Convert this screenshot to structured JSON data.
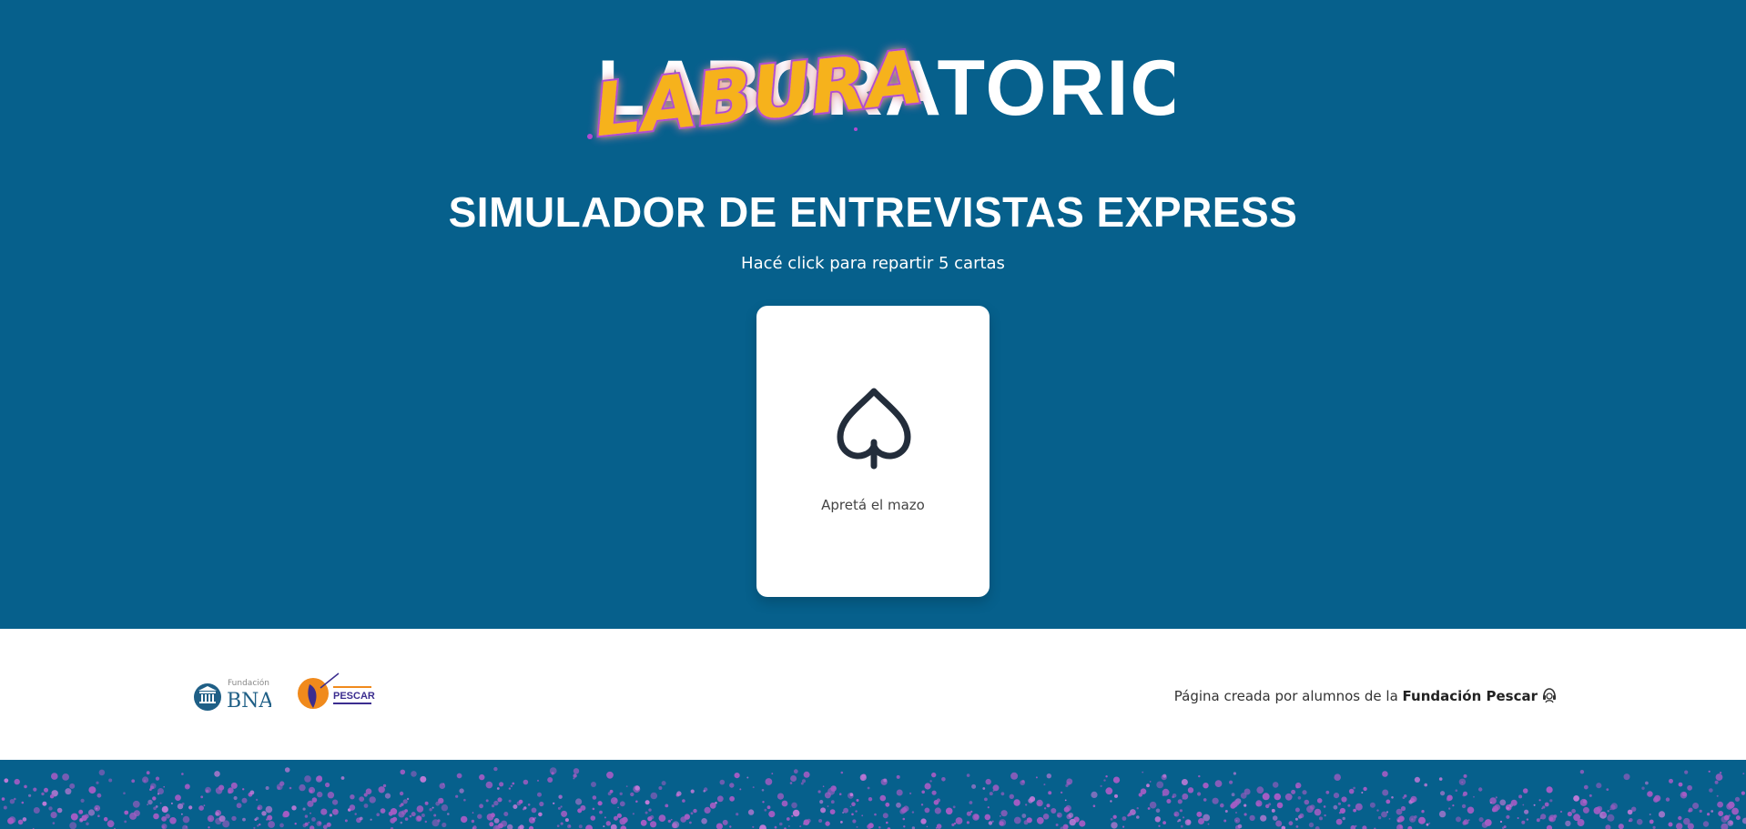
{
  "logo": {
    "word_behind": "LABORATORIO",
    "word_overlay": "LABURA",
    "word_tail": "TORIO"
  },
  "hero": {
    "title": "SIMULADOR DE ENTREVISTAS EXPRESS",
    "subtitle": "Hacé click para repartir 5 cartas"
  },
  "deck": {
    "icon": "spade-icon",
    "label": "Apretá el mazo"
  },
  "footer": {
    "sponsor_1": {
      "small": "Fundación",
      "big": "BNA"
    },
    "sponsor_2": {
      "name": "PESCAR"
    },
    "credit_prefix": "Página creada por alumnos de la ",
    "credit_org": "Fundación Pescar",
    "credit_icon": "headset-icon"
  },
  "colors": {
    "background": "#06608c",
    "card": "#ffffff",
    "accent_yellow": "#f6b21c",
    "accent_purple": "#b14bd1"
  }
}
